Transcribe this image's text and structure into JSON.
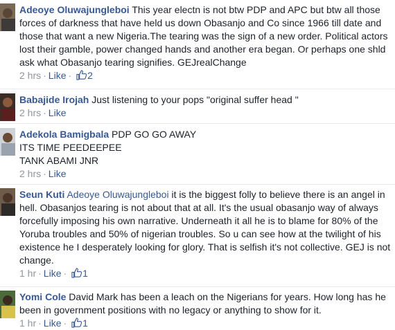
{
  "comments": [
    {
      "author": "Adeoye Oluwajungleboi",
      "mention": "",
      "text": " This year electn is not btw PDP and APC but btw all those forces of darkness that have held us down Obasanjo and Co since 1966 till date and those that want a new Nigeria.The tearing was the sign of a new order. Political actors lost their gamble, power changed hands and another era began. Or perhaps one shld ask what Obasanjo tearing signifies. GEJrealChange",
      "time": "2 hrs",
      "like_label": "Like",
      "like_count": "2"
    },
    {
      "author": "Babajide Irojah",
      "mention": "",
      "text": " Just listening to your pops \"original suffer head \"",
      "time": "2 hrs",
      "like_label": "Like",
      "like_count": ""
    },
    {
      "author": "Adekola Bamigbala",
      "mention": "",
      "text": " PDP GO GO AWAY",
      "text_line2": "ITS TIME PEEDEEPEE",
      "text_line3": "TANK ABAMI JNR",
      "time": "2 hrs",
      "like_label": "Like",
      "like_count": ""
    },
    {
      "author": "Seun Kuti",
      "mention": "Adeoye Oluwajungleboi",
      "text": " it is the biggest folly to believe there is an angel in hell. Obasanjos tearing is not about that at all. It's the usual obasanjo way of always forcefully imposing his own narrative. Underneath it all he is to blame for 80% of the Yoruba troubles and 50% of nigerian troubles. So u can see how at the twilight of his existence he I desperately looking for glory. That is selfish it's not collective. GEJ is not change.",
      "time": "1 hr",
      "like_label": "Like",
      "like_count": "1"
    },
    {
      "author": "Yomi Cole",
      "mention": "",
      "text": " David Mark has been a leach on the Nigerians for years. How long has he been in government positions with no legacy or anything to show for it.",
      "time": "1 hr",
      "like_label": "Like",
      "like_count": "1"
    }
  ],
  "colors": {
    "link": "#365899",
    "meta": "#90949c",
    "text": "#1d2129"
  }
}
